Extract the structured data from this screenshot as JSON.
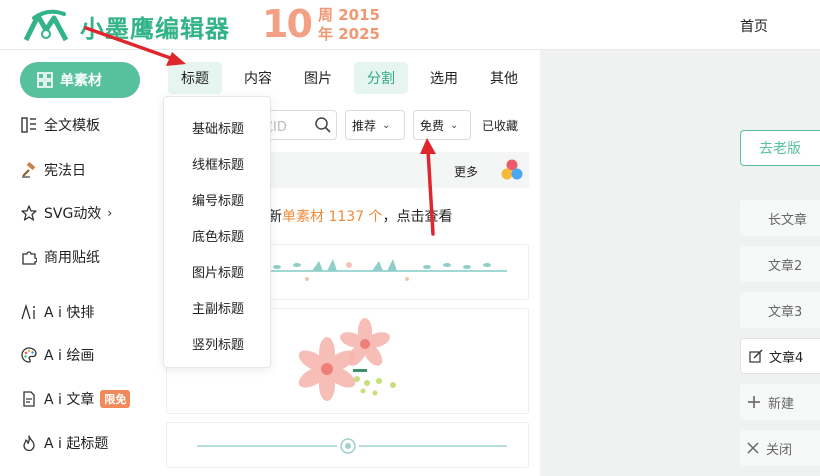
{
  "header": {
    "brand": "小墨鹰编辑器",
    "anniv_num": "10",
    "anniv_line1": "周 2015",
    "anniv_line2": "年 2025",
    "home": "首页"
  },
  "sidebar": {
    "items": [
      {
        "label": "单素材",
        "icon": "grid-icon"
      },
      {
        "label": "全文模板",
        "icon": "layout-icon"
      },
      {
        "label": "宪法日",
        "icon": "gavel-icon"
      },
      {
        "label": "SVG动效",
        "icon": "star-icon",
        "chevron": "›"
      },
      {
        "label": "商用贴纸",
        "icon": "puzzle-icon"
      },
      {
        "label": "A i 快排",
        "icon": "ai-icon"
      },
      {
        "label": "A i 绘画",
        "icon": "palette-icon"
      },
      {
        "label": "A i 文章",
        "icon": "doc-icon",
        "badge": "限免"
      },
      {
        "label": "A i 起标题",
        "icon": "fire-icon"
      }
    ]
  },
  "tabs": [
    "标题",
    "内容",
    "图片",
    "分割",
    "选用",
    "其他"
  ],
  "dropdown": [
    "基础标题",
    "线框标题",
    "编号标题",
    "底色标题",
    "图片标题",
    "主副标题",
    "竖列标题"
  ],
  "toolbar": {
    "search_partial": "或ID",
    "filter_recommend": "推荐",
    "filter_free": "免费",
    "favorites": "已收藏",
    "more": "更多"
  },
  "notice": {
    "prefix": "新",
    "highlight": "单素材 1137 个",
    "suffix": "，点击查看"
  },
  "right": {
    "old_version": "去老版",
    "articles": [
      "长文章",
      "文章2",
      "文章3",
      "文章4"
    ],
    "new": "新建",
    "close": "关闭"
  },
  "colors": {
    "accent": "#57c09c",
    "brand": "#33b389",
    "anniversary": "#f2a184",
    "highlight": "#f08a3a",
    "arrow": "#e0262d"
  }
}
